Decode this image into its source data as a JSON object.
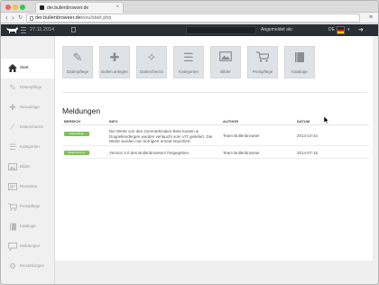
{
  "browser": {
    "tab_title": "der.bullenbrowser.de",
    "url_host": "der.bullenbrowser.de",
    "url_path": "/neu/start.php"
  },
  "header": {
    "date": "27.11.2014",
    "logged_in_label": "Angemeldet als:",
    "lang_label": "DE"
  },
  "sidebar": {
    "items": [
      {
        "label": "Start",
        "icon": "home-icon"
      },
      {
        "label": "Datenpflege",
        "icon": "edit-icon"
      },
      {
        "label": "Neuanlage",
        "icon": "plus-icon"
      },
      {
        "label": "Datenchecks",
        "icon": "magic-wand-icon"
      },
      {
        "label": "Kategorien",
        "icon": "list-icon"
      },
      {
        "label": "Bilder",
        "icon": "image-icon"
      },
      {
        "label": "Rezepten",
        "icon": "recipe-icon"
      },
      {
        "label": "Preispflege",
        "icon": "cart-icon"
      },
      {
        "label": "Kataloge",
        "icon": "book-icon"
      },
      {
        "label": "Meldungen",
        "icon": "messages-icon"
      },
      {
        "label": "Einstellungen",
        "icon": "gear-icon"
      }
    ]
  },
  "tiles": [
    {
      "label": "Datenpflege",
      "icon": "edit-icon"
    },
    {
      "label": "Bullen anlegen",
      "icon": "plus-icon"
    },
    {
      "label": "Datenchecks",
      "icon": "magic-wand-icon"
    },
    {
      "label": "Kategorien",
      "icon": "list-icon"
    },
    {
      "label": "Bilder",
      "icon": "image-icon"
    },
    {
      "label": "Preispflege",
      "icon": "cart-icon"
    },
    {
      "label": "Kataloge",
      "icon": "book-icon"
    }
  ],
  "meldungen": {
    "title": "Meldungen",
    "columns": {
      "bereich": "BEREICH",
      "info": "INFO",
      "author": "AUTHOR",
      "datum": "DATUM"
    },
    "rows": [
      {
        "bereich": "Datenpflege",
        "info": "Die Werte von den Genmerkmalen Beta Kasein & Doppellendergen wurden verlaucht vom VIT geliefert. Die Werte wurden nun korrigiert erneut importiert.",
        "author": "Team Bullenbrowser",
        "datum": "2014-10-22"
      },
      {
        "bereich": "Bullenbrowser",
        "info": "Version 2.0 des Bullenbrowsers freigegeben.",
        "author": "Team Bullenbrowser",
        "datum": "2014-07-15"
      }
    ]
  },
  "colors": {
    "header_bg": "#2a2f36",
    "badge_green": "#7fbf5a",
    "tile_bg": "#dfe2e6"
  }
}
